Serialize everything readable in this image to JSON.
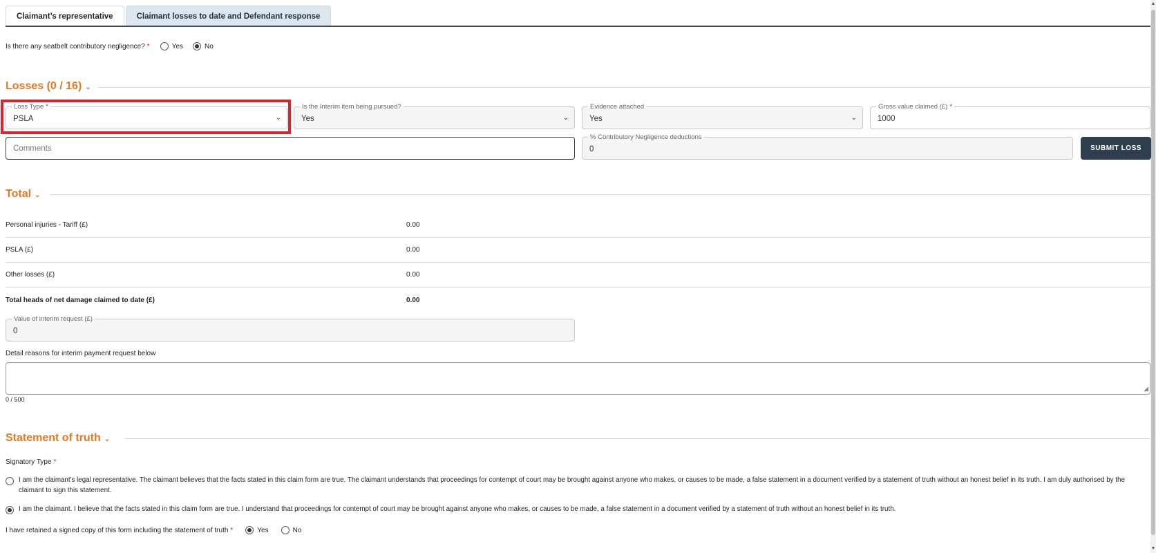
{
  "tabs": [
    {
      "label": "Claimant’s representative"
    },
    {
      "label": "Claimant losses to date and Defendant response"
    }
  ],
  "seatbelt": {
    "question": "Is there any seatbelt contributory negligence?",
    "required_mark": "*",
    "options": [
      "Yes",
      "No"
    ],
    "selected": "No"
  },
  "losses": {
    "title": "Losses (0 / 16)",
    "loss_type": {
      "label": "Loss Type",
      "required_mark": "*",
      "value": "PSLA"
    },
    "interim": {
      "label": "Is the Interim item being pursued?",
      "value": "Yes"
    },
    "evidence": {
      "label": "Evidence attached",
      "value": "Yes"
    },
    "gross": {
      "label": "Gross value claimed (£)",
      "required_mark": "*",
      "value": "1000"
    },
    "comments": {
      "placeholder": "Comments"
    },
    "contributory": {
      "label": "% Contributory Negligence deductions",
      "value": "0"
    },
    "submit_label": "SUBMIT LOSS"
  },
  "total": {
    "title": "Total",
    "rows": [
      {
        "label": "Personal injuries - Tariff (£)",
        "value": "0.00"
      },
      {
        "label": "PSLA (£)",
        "value": "0.00"
      },
      {
        "label": "Other losses (£)",
        "value": "0.00"
      },
      {
        "label": "Total heads of net damage claimed to date (£)",
        "value": "0.00"
      }
    ],
    "interim_request": {
      "label": "Value of interim request (£)",
      "value": "0"
    },
    "detail_label": "Detail reasons for interim payment request below",
    "char_count": "0 / 500"
  },
  "statement": {
    "title": "Statement of truth",
    "signatory_label": "Signatory Type",
    "required_mark": "*",
    "options": [
      {
        "text": "I am the claimant's legal representative. The claimant believes that the facts stated in this claim form are true. The claimant understands that proceedings for contempt of court may be brought against anyone who makes, or causes to be made, a false statement in a document verified by a statement of truth without an honest belief in its truth. I am duly authorised by the claimant to sign this statement."
      },
      {
        "text": "I am the claimant. I believe that the facts stated in this claim form are true. I understand that proceedings for contempt of court may be brought against anyone who makes, or causes to be made, a false statement in a document verified by a statement of truth without an honest belief in its truth."
      }
    ],
    "selected_index": 1,
    "retained": {
      "question": "I have retained a signed copy of this form including the statement of truth",
      "required_mark": "*",
      "options": [
        "Yes",
        "No"
      ],
      "selected": "Yes"
    }
  },
  "colors": {
    "accent": "#e87722",
    "highlight": "#e0202a",
    "button": "#2f3e4e",
    "active_tab": "#dce6ee"
  }
}
